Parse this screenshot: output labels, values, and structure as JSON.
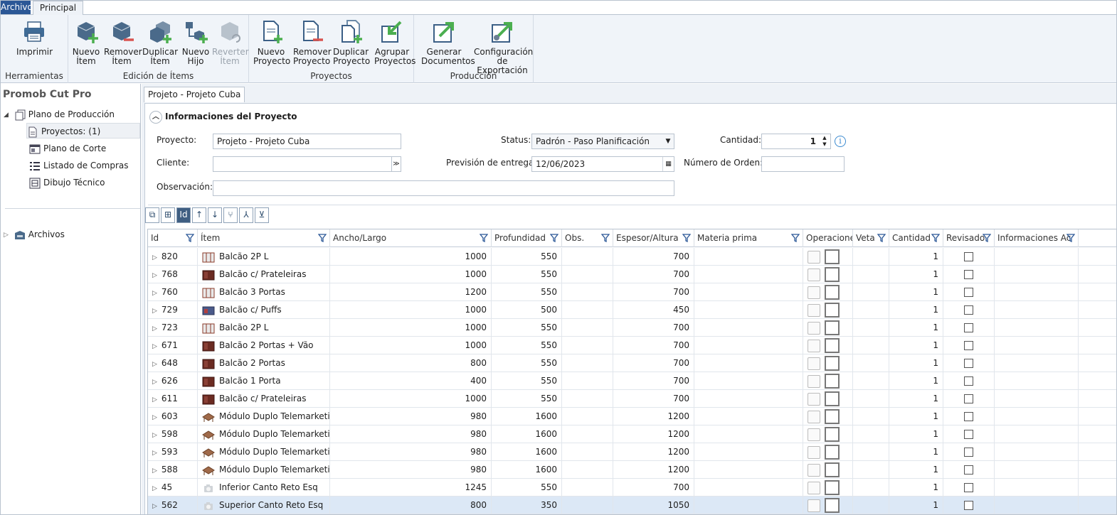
{
  "tabs": {
    "file": "Archivo",
    "main": "Principal"
  },
  "ribbon": {
    "groups": [
      {
        "label": "Herramientas",
        "buttons": [
          {
            "label": "Imprimir",
            "icon": "printer-icon",
            "disabled": false
          }
        ]
      },
      {
        "label": "Edición de Ítems",
        "buttons": [
          {
            "label": "Nuevo Ítem",
            "icon": "new-item-icon",
            "disabled": false
          },
          {
            "label": "Remover Ítem",
            "icon": "remove-item-icon",
            "disabled": false
          },
          {
            "label": "Duplicar Ítem",
            "icon": "duplicate-item-icon",
            "disabled": false
          },
          {
            "label": "Nuevo Hijo",
            "icon": "new-child-icon",
            "disabled": false
          },
          {
            "label": "Reverter Ítem",
            "icon": "revert-item-icon",
            "disabled": true
          }
        ]
      },
      {
        "label": "Proyectos",
        "buttons": [
          {
            "label": "Nuevo Proyecto",
            "icon": "new-project-icon",
            "disabled": false
          },
          {
            "label": "Remover Proyecto",
            "icon": "remove-project-icon",
            "disabled": false
          },
          {
            "label": "Duplicar Proyecto",
            "icon": "duplicate-project-icon",
            "disabled": false
          },
          {
            "label": "Agrupar Proyectos",
            "icon": "group-projects-icon",
            "disabled": false
          }
        ]
      },
      {
        "label": "Producción",
        "buttons": [
          {
            "label": "Generar Documentos",
            "icon": "generate-documents-icon",
            "disabled": false
          },
          {
            "label": "Configuración de Exportación",
            "icon": "export-config-icon",
            "disabled": false
          }
        ]
      }
    ]
  },
  "tree": {
    "title": "Promob Cut Pro",
    "root": "Plano de Producción",
    "children": [
      "Proyectos: (1)",
      "Plano de Corte",
      "Listado de Compras",
      "Dibujo Técnico"
    ],
    "archives": "Archivos"
  },
  "doc_tab": "Projeto - Projeto Cuba",
  "info": {
    "title": "Informaciones del Proyecto",
    "project_label": "Proyecto:",
    "project_value": "Projeto - Projeto Cuba",
    "client_label": "Cliente:",
    "client_value": "",
    "obs_label": "Observación:",
    "obs_value": "",
    "status_label": "Status:",
    "status_value": "Padrón - Paso Planificación",
    "delivery_label": "Previsión de entrega:",
    "delivery_value": "12/06/2023",
    "qty_label": "Cantidad:",
    "qty_value": "1",
    "order_label": "Número de Orden:",
    "order_value": ""
  },
  "grid": {
    "columns": [
      "Id",
      "Ítem",
      "Ancho/Largo",
      "Profundidad",
      "Obs.",
      "Espesor/Altura",
      "Materia prima",
      "Operaciones",
      "Veta",
      "Cantidad",
      "Revisado",
      "Informaciones Ac"
    ],
    "rows": [
      {
        "id": "820",
        "item": "Balcão 2P L",
        "ancho": "1000",
        "prof": "550",
        "esp": "700",
        "qty": "1",
        "thumb": "white-cabinet"
      },
      {
        "id": "768",
        "item": "Balcão c/ Prateleiras",
        "ancho": "1000",
        "prof": "550",
        "esp": "700",
        "qty": "1",
        "thumb": "dark-cabinet"
      },
      {
        "id": "760",
        "item": "Balcão 3 Portas",
        "ancho": "1200",
        "prof": "550",
        "esp": "700",
        "qty": "1",
        "thumb": "white-cabinet"
      },
      {
        "id": "729",
        "item": "Balcão c/ Puffs",
        "ancho": "1000",
        "prof": "500",
        "esp": "450",
        "qty": "1",
        "thumb": "blue-cabinet"
      },
      {
        "id": "723",
        "item": "Balcão 2P L",
        "ancho": "1000",
        "prof": "550",
        "esp": "700",
        "qty": "1",
        "thumb": "white-cabinet"
      },
      {
        "id": "671",
        "item": "Balcão 2 Portas + Vão",
        "ancho": "1000",
        "prof": "550",
        "esp": "700",
        "qty": "1",
        "thumb": "dark-cabinet"
      },
      {
        "id": "648",
        "item": "Balcão 2 Portas",
        "ancho": "800",
        "prof": "550",
        "esp": "700",
        "qty": "1",
        "thumb": "dark-cabinet"
      },
      {
        "id": "626",
        "item": "Balcão 1 Porta",
        "ancho": "400",
        "prof": "550",
        "esp": "700",
        "qty": "1",
        "thumb": "dark-cabinet"
      },
      {
        "id": "611",
        "item": "Balcão c/ Prateleiras",
        "ancho": "1000",
        "prof": "550",
        "esp": "700",
        "qty": "1",
        "thumb": "dark-cabinet"
      },
      {
        "id": "603",
        "item": "Módulo Duplo Telemarketing",
        "ancho": "980",
        "prof": "1600",
        "esp": "1200",
        "qty": "1",
        "thumb": "desk"
      },
      {
        "id": "598",
        "item": "Módulo Duplo Telemarketing",
        "ancho": "980",
        "prof": "1600",
        "esp": "1200",
        "qty": "1",
        "thumb": "desk"
      },
      {
        "id": "593",
        "item": "Módulo Duplo Telemarketing",
        "ancho": "980",
        "prof": "1600",
        "esp": "1200",
        "qty": "1",
        "thumb": "desk"
      },
      {
        "id": "588",
        "item": "Módulo Duplo Telemarketing",
        "ancho": "980",
        "prof": "1600",
        "esp": "1200",
        "qty": "1",
        "thumb": "desk"
      },
      {
        "id": "45",
        "item": "Inferior Canto Reto Esq",
        "ancho": "1245",
        "prof": "550",
        "esp": "700",
        "qty": "1",
        "thumb": "camera"
      },
      {
        "id": "562",
        "item": "Superior Canto Reto Esq",
        "ancho": "800",
        "prof": "350",
        "esp": "1050",
        "qty": "1",
        "thumb": "camera",
        "selected": true
      }
    ]
  },
  "colors": {
    "accent": "#2b5796",
    "ribbon_bg": "#f0f4f9",
    "green": "#4caf50",
    "red": "#d9534f",
    "selection": "#dce8f6"
  }
}
